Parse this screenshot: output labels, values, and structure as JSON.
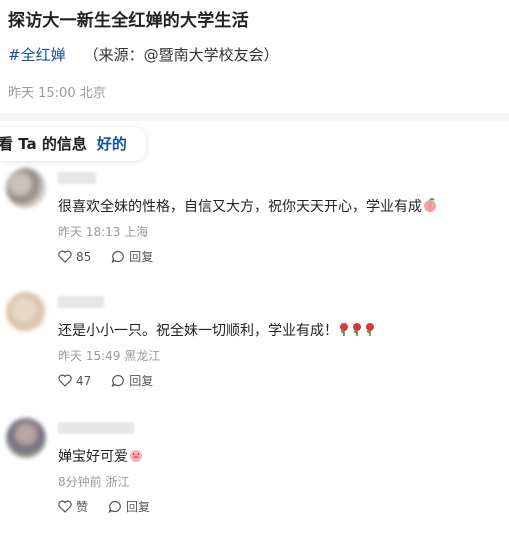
{
  "article": {
    "title": "探访大一新生全红婵的大学生活",
    "hashtag": "#全红婵",
    "source": "（来源：@暨南大学校友会）",
    "time": "昨天 15:00",
    "location": "北京"
  },
  "popup": {
    "question": "看 Ta 的信息",
    "confirm": "好的"
  },
  "comments": [
    {
      "text": "很喜欢全妹的性格，自信又大方，祝你天天开心，学业有成",
      "emoji": "peach",
      "time": "昨天 18:13",
      "location": "上海",
      "likes": "85",
      "reply_label": "回复"
    },
    {
      "text": "还是小小一只。祝全妹一切顺利，学业有成！",
      "emoji": "three-roses",
      "time": "昨天 15:49",
      "location": "黑龙江",
      "likes": "47",
      "reply_label": "回复"
    },
    {
      "text": "婵宝好可爱",
      "emoji": "pig-face",
      "time": "8分钟前",
      "location": "浙江",
      "likes": "赞",
      "reply_label": "回复"
    }
  ]
}
